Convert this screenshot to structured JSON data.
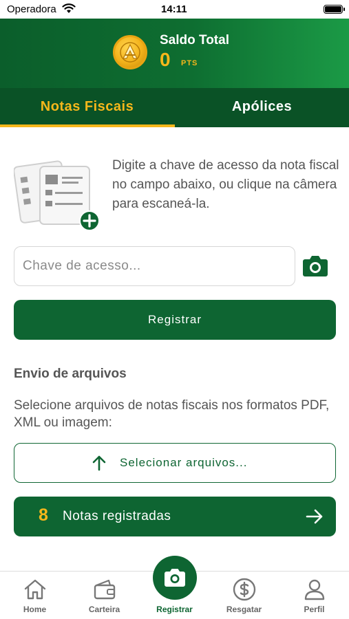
{
  "status_bar": {
    "carrier": "Operadora",
    "time": "14:11"
  },
  "header": {
    "balance_label": "Saldo Total",
    "balance_value": "0",
    "balance_unit": "PTS"
  },
  "tabs": [
    {
      "label": "Notas Fiscais",
      "active": true
    },
    {
      "label": "Apólices",
      "active": false
    }
  ],
  "intro": {
    "text": "Digite a chave de acesso da nota fiscal no campo abaixo, ou clique na câmera para escaneá-la."
  },
  "access_key": {
    "placeholder": "Chave de acesso...",
    "value": ""
  },
  "register_button": {
    "label": "Registrar"
  },
  "upload": {
    "title": "Envio de arquivos",
    "description": "Selecione arquivos de notas fiscais nos formatos PDF, XML ou imagem:",
    "button_label": "Selecionar arquivos..."
  },
  "registered_notes": {
    "count": "8",
    "label": "Notas registradas"
  },
  "bottom_nav": [
    {
      "label": "Home",
      "icon": "home-icon"
    },
    {
      "label": "Carteira",
      "icon": "wallet-icon"
    },
    {
      "label": "Registrar",
      "icon": "camera-icon",
      "active": true
    },
    {
      "label": "Resgatar",
      "icon": "dollar-icon"
    },
    {
      "label": "Perfil",
      "icon": "user-icon"
    }
  ],
  "colors": {
    "primary_green": "#0e6532",
    "accent_yellow": "#f6b71b",
    "tab_bar": "#0a5226"
  }
}
